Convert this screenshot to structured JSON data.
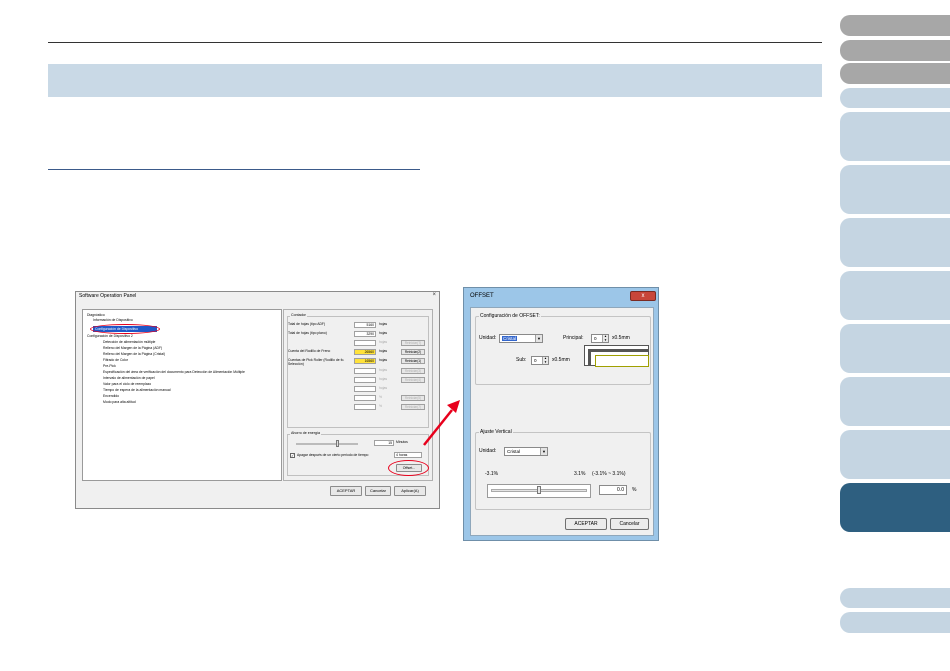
{
  "software_panel": {
    "title": "Software Operation Panel",
    "close_glyph": "×",
    "tree": [
      "Diagnóstico",
      "Información de Dispositivo",
      "Configuración de Dispositivo",
      "Configuración de Dispositivo 2",
      "Detección de alimentación múltiple",
      "Relleno del Margen de la Página (ADF)",
      "Relleno del Margen de la Página (Cristal)",
      "Filtrado de Color",
      "Pre-Pick",
      "Especificación del área de verificación del documento para Detección de Alimentación Múltiple",
      "Intervalo de alimentación de papel",
      "Valor para el ciclo de reemplazo",
      "Tiempo de espera de la alimentación manual",
      "Encendido",
      "Modo para alta altitud"
    ],
    "counters": {
      "label": "Contador",
      "rows": [
        {
          "label": "Total de hojas (tipo ADF)",
          "value": "5160",
          "unit": "hojas",
          "button": "",
          "highlight": false
        },
        {
          "label": "Total de hojas (tipo plano)",
          "value": "3290",
          "unit": "hojas",
          "button": "",
          "highlight": false
        },
        {
          "label": "",
          "value": "",
          "unit": "hojas",
          "button": "Reiniciar(T)",
          "highlight": false,
          "dim": true
        },
        {
          "label": "Cuenta del Rodillo de Freno",
          "value": "26560",
          "unit": "hojas",
          "button": "Reiniciar(2)",
          "highlight": true
        },
        {
          "label": "Cuentas de Pick Roller (Rodillo de fo. Selección)",
          "value": "16560",
          "unit": "hojas",
          "button": "Reiniciar(1)",
          "highlight": true
        },
        {
          "label": "",
          "value": "",
          "unit": "hojas",
          "button": "Reiniciar(3)",
          "highlight": false,
          "dim": true
        },
        {
          "label": "",
          "value": "",
          "unit": "hojas",
          "button": "Reiniciar(4)",
          "highlight": false,
          "dim": true
        },
        {
          "label": "",
          "value": "",
          "unit": "hojas",
          "button": "",
          "highlight": false
        },
        {
          "label": "",
          "value": "",
          "unit": "%",
          "button": "Reiniciar(5)",
          "highlight": false,
          "dim": true
        },
        {
          "label": "",
          "value": "",
          "unit": "%",
          "button": "Reiniciar(7)",
          "highlight": false,
          "dim": true
        }
      ]
    },
    "energy": {
      "label": "Ahorro de energía",
      "minutes_value": "15",
      "minutes_unit": "Minutos",
      "checkbox_label": "Apagar después de un cierto periodo de tiempo",
      "hours_value": "4 horas"
    },
    "offset_button": "Offset...",
    "buttons": {
      "ok": "ACEPTAR",
      "cancel": "Cancelar",
      "apply": "Aplicar(A)"
    }
  },
  "offset_dialog": {
    "title": "OFFSET",
    "close_glyph": "x",
    "group_offset": "Configuración de OFFSET:",
    "unit_label": "Unidad:",
    "unit_value": "Cristal",
    "principal_label": "Principal:",
    "principal_value": "0",
    "principal_unit": "x0.5mm",
    "sub_label": "Sub:",
    "sub_value": "0",
    "sub_unit": "x0.5mm",
    "group_vertical": "Ajuste Vertical",
    "unit2_label": "Unidad:",
    "unit2_value": "Cristal",
    "range_min": "-3.1%",
    "range_max": "3.1%",
    "range_text": "(-3.1% ~ 3.1%)",
    "adjust_value": "0.0",
    "adjust_unit": "%",
    "adjust_level": 0.5,
    "ok": "ACEPTAR",
    "cancel": "Cancelar"
  },
  "colors": {
    "band": "#c9d9e6",
    "tab_active": "#2e5f80",
    "tab_gray": "#a7a7a7",
    "tab_light": "#c5d5e2",
    "highlight_ellipse": "#e8001c",
    "arrow": "#e8001c"
  }
}
